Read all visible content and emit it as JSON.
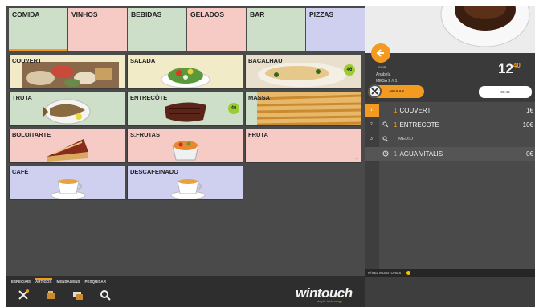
{
  "categories": [
    {
      "label": "COMIDA",
      "color": "#cddec9",
      "active": true
    },
    {
      "label": "VINHOS",
      "color": "#f6cbc6",
      "active": false
    },
    {
      "label": "BEBIDAS",
      "color": "#cddec9",
      "active": false
    },
    {
      "label": "GELADOS",
      "color": "#f6cbc6",
      "active": false
    },
    {
      "label": "BAR",
      "color": "#cddec9",
      "active": false
    },
    {
      "label": "PIZZAS",
      "color": "#cfcff0",
      "active": false
    }
  ],
  "items": {
    "couvert": {
      "label": "COUVERT",
      "color": "#f1ebc7"
    },
    "salada": {
      "label": "SALADA",
      "color": "#f1ebc7"
    },
    "bacalhau": {
      "label": "BACALHAU",
      "color": "#f1ebc7",
      "badge": "46"
    },
    "truta": {
      "label": "TRUTA",
      "color": "#cddec9"
    },
    "entrecote": {
      "label": "ENTRECÔTE",
      "color": "#cddec9",
      "badge": "46"
    },
    "massa": {
      "label": "MASSA",
      "color": "#cddec9"
    },
    "bolo": {
      "label": "BOLO/TARTE",
      "color": "#f6cbc6"
    },
    "sfrutas": {
      "label": "S.FRUTAS",
      "color": "#f6cbc6"
    },
    "fruta": {
      "label": "FRUTA",
      "color": "#f6cbc6",
      "more": "»"
    },
    "cafe": {
      "label": "CAFÉ",
      "color": "#cfcff0"
    },
    "descafeinado": {
      "label": "DESCAFEINADO",
      "color": "#cfcff0"
    }
  },
  "bottom": {
    "tabs": [
      "ESPECIAIS",
      "ARTIGOS",
      "MENSAGENS",
      "PESQUISAR"
    ],
    "active_tab": "ARTIGOS",
    "brand": "wintouch",
    "brand_sub": "simple technology"
  },
  "order": {
    "sair": "SAIR",
    "user": "Anabela",
    "mesa": "MESA 2 // 1",
    "clock_main": "12",
    "clock_small": "40",
    "anular": "ANULAR",
    "time": "09:46",
    "lines": [
      {
        "n": "1",
        "qty": "1",
        "text": "COUVERT",
        "price": "1€"
      },
      {
        "n": "2",
        "qty": "1",
        "text": "ENTRECOTE",
        "price": "10€"
      },
      {
        "n": "3",
        "sub": "MEDIO"
      },
      {
        "n": "",
        "qty": "1",
        "text": "AGUA VITALIS",
        "price": "0€"
      }
    ],
    "monitor_label": "NÍVEL MONITORES"
  },
  "accent": "#f39a20"
}
